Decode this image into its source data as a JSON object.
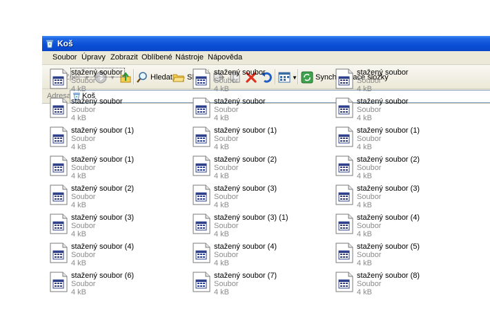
{
  "window": {
    "title": "Koš"
  },
  "menu": [
    {
      "label": "Soubor"
    },
    {
      "label": "Úpravy"
    },
    {
      "label": "Zobrazit"
    },
    {
      "label": "Oblíbené"
    },
    {
      "label": "Nástroje"
    },
    {
      "label": "Nápověda"
    }
  ],
  "toolbar": {
    "back_label": "Zpět",
    "search_label": "Hledat",
    "folders_label": "Složky",
    "sync_label": "Synchronizace složky"
  },
  "address": {
    "label": "Adresa",
    "value": "Koš"
  },
  "files": [
    {
      "name": "stažený soubor",
      "type": "Soubor",
      "size": "4 kB"
    },
    {
      "name": "stažený soubor",
      "type": "Soubor",
      "size": "4 kB"
    },
    {
      "name": "stažený soubor",
      "type": "Soubor",
      "size": "4 kB"
    },
    {
      "name": "stažený soubor",
      "type": "Soubor",
      "size": "4 kB"
    },
    {
      "name": "stažený soubor",
      "type": "Soubor",
      "size": "4 kB"
    },
    {
      "name": "stažený soubor",
      "type": "Soubor",
      "size": "4 kB"
    },
    {
      "name": "stažený soubor (1)",
      "type": "Soubor",
      "size": "4 kB"
    },
    {
      "name": "stažený soubor (1)",
      "type": "Soubor",
      "size": "4 kB"
    },
    {
      "name": "stažený soubor (1)",
      "type": "Soubor",
      "size": "4 kB"
    },
    {
      "name": "stažený soubor (1)",
      "type": "Soubor",
      "size": "4 kB"
    },
    {
      "name": "stažený soubor (2)",
      "type": "Soubor",
      "size": "4 kB"
    },
    {
      "name": "stažený soubor (2)",
      "type": "Soubor",
      "size": "4 kB"
    },
    {
      "name": "stažený soubor (2)",
      "type": "Soubor",
      "size": "4 kB"
    },
    {
      "name": "stažený soubor (3)",
      "type": "Soubor",
      "size": "4 kB"
    },
    {
      "name": "stažený soubor (3)",
      "type": "Soubor",
      "size": "4 kB"
    },
    {
      "name": "stažený soubor (3)",
      "type": "Soubor",
      "size": "4 kB"
    },
    {
      "name": "stažený soubor (3) (1)",
      "type": "Soubor",
      "size": "4 kB"
    },
    {
      "name": "stažený soubor (4)",
      "type": "Soubor",
      "size": "4 kB"
    },
    {
      "name": "stažený soubor (4)",
      "type": "Soubor",
      "size": "4 kB"
    },
    {
      "name": "stažený soubor (4)",
      "type": "Soubor",
      "size": "4 kB"
    },
    {
      "name": "stažený soubor (5)",
      "type": "Soubor",
      "size": "4 kB"
    },
    {
      "name": "stažený soubor (6)",
      "type": "Soubor",
      "size": "4 kB"
    },
    {
      "name": "stažený soubor (7)",
      "type": "Soubor",
      "size": "4 kB"
    },
    {
      "name": "stažený soubor (8)",
      "type": "Soubor",
      "size": "4 kB"
    }
  ],
  "icons": {
    "window": "recycle-bin-icon",
    "file": "generic-file-icon",
    "back": "back-arrow-icon",
    "forward": "forward-arrow-icon",
    "up": "up-folder-icon",
    "search": "search-icon",
    "folders": "folders-icon",
    "move": "move-to-icon",
    "copy": "copy-to-icon",
    "delete": "delete-icon",
    "undo": "undo-icon",
    "views": "views-icon",
    "sync": "sync-icon"
  },
  "colors": {
    "titlebar": "#0a4fd6",
    "chrome": "#ece9d8",
    "delete": "#e0301e"
  }
}
